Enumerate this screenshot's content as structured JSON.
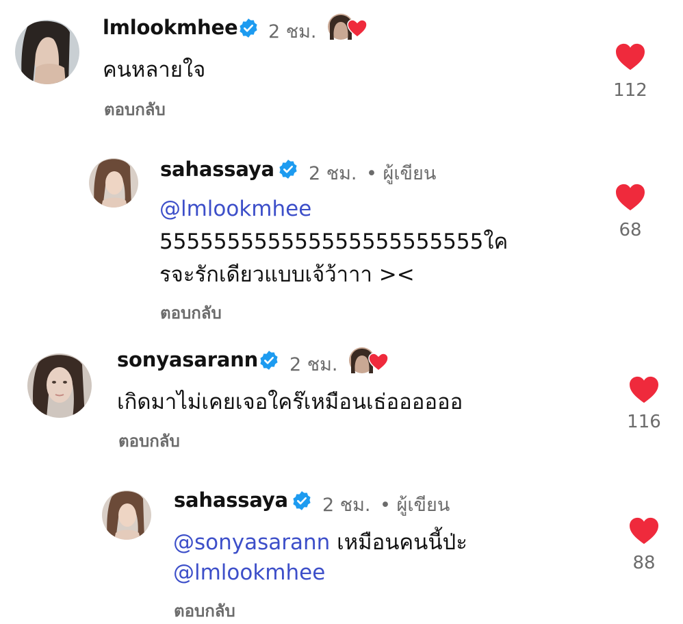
{
  "comments": [
    {
      "username": "lmlookmhee",
      "time": "2 ชม.",
      "text": "คนหลายใจ",
      "reply_label": "ตอบกลับ",
      "likes": "112",
      "author_liked": true
    },
    {
      "username": "sahassaya",
      "time": "2 ชม.",
      "author_badge": "• ผู้เขียน",
      "mention": "@lmlookmhee",
      "text_line2": "555555555555555555555555ใค",
      "text_line3": "รจะรักเดียวแบบเจ้ว้าาา ><",
      "reply_label": "ตอบกลับ",
      "likes": "68"
    },
    {
      "username": "sonyasarann",
      "time": "2 ชม.",
      "text": "เกิดมาไม่เคยเจอใคร๊เหมือนเธ่ออออออ",
      "reply_label": "ตอบกลับ",
      "likes": "116",
      "author_liked": true
    },
    {
      "username": "sahassaya",
      "time": "2 ชม.",
      "author_badge": "• ผู้เขียน",
      "mention1": "@sonyasarann",
      "text_after_mention": " เหมือนคนนี้ป่ะ",
      "mention2": "@lmlookmhee",
      "reply_label": "ตอบกลับ",
      "likes": "88"
    }
  ],
  "colors": {
    "heart": "#ef2a3c",
    "verified": "#1d9bf0",
    "mention": "#3d4fc9",
    "muted": "#6b6b6b"
  },
  "icons": [
    "verified-badge-icon",
    "heart-icon",
    "author-liked-avatar-icon"
  ]
}
